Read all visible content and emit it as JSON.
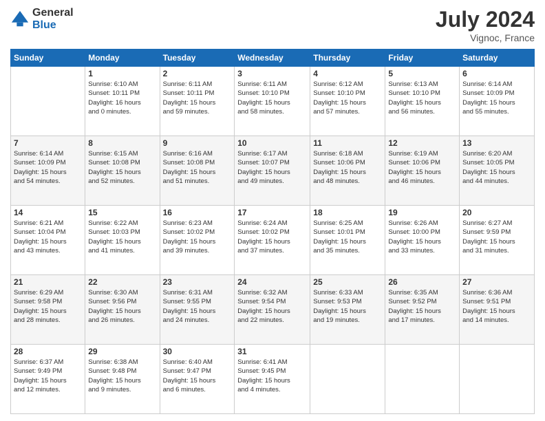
{
  "header": {
    "logo_general": "General",
    "logo_blue": "Blue",
    "month_year": "July 2024",
    "location": "Vignoc, France"
  },
  "weekdays": [
    "Sunday",
    "Monday",
    "Tuesday",
    "Wednesday",
    "Thursday",
    "Friday",
    "Saturday"
  ],
  "weeks": [
    [
      {
        "day": "",
        "info": ""
      },
      {
        "day": "1",
        "info": "Sunrise: 6:10 AM\nSunset: 10:11 PM\nDaylight: 16 hours\nand 0 minutes."
      },
      {
        "day": "2",
        "info": "Sunrise: 6:11 AM\nSunset: 10:11 PM\nDaylight: 15 hours\nand 59 minutes."
      },
      {
        "day": "3",
        "info": "Sunrise: 6:11 AM\nSunset: 10:10 PM\nDaylight: 15 hours\nand 58 minutes."
      },
      {
        "day": "4",
        "info": "Sunrise: 6:12 AM\nSunset: 10:10 PM\nDaylight: 15 hours\nand 57 minutes."
      },
      {
        "day": "5",
        "info": "Sunrise: 6:13 AM\nSunset: 10:10 PM\nDaylight: 15 hours\nand 56 minutes."
      },
      {
        "day": "6",
        "info": "Sunrise: 6:14 AM\nSunset: 10:09 PM\nDaylight: 15 hours\nand 55 minutes."
      }
    ],
    [
      {
        "day": "7",
        "info": "Sunrise: 6:14 AM\nSunset: 10:09 PM\nDaylight: 15 hours\nand 54 minutes."
      },
      {
        "day": "8",
        "info": "Sunrise: 6:15 AM\nSunset: 10:08 PM\nDaylight: 15 hours\nand 52 minutes."
      },
      {
        "day": "9",
        "info": "Sunrise: 6:16 AM\nSunset: 10:08 PM\nDaylight: 15 hours\nand 51 minutes."
      },
      {
        "day": "10",
        "info": "Sunrise: 6:17 AM\nSunset: 10:07 PM\nDaylight: 15 hours\nand 49 minutes."
      },
      {
        "day": "11",
        "info": "Sunrise: 6:18 AM\nSunset: 10:06 PM\nDaylight: 15 hours\nand 48 minutes."
      },
      {
        "day": "12",
        "info": "Sunrise: 6:19 AM\nSunset: 10:06 PM\nDaylight: 15 hours\nand 46 minutes."
      },
      {
        "day": "13",
        "info": "Sunrise: 6:20 AM\nSunset: 10:05 PM\nDaylight: 15 hours\nand 44 minutes."
      }
    ],
    [
      {
        "day": "14",
        "info": "Sunrise: 6:21 AM\nSunset: 10:04 PM\nDaylight: 15 hours\nand 43 minutes."
      },
      {
        "day": "15",
        "info": "Sunrise: 6:22 AM\nSunset: 10:03 PM\nDaylight: 15 hours\nand 41 minutes."
      },
      {
        "day": "16",
        "info": "Sunrise: 6:23 AM\nSunset: 10:02 PM\nDaylight: 15 hours\nand 39 minutes."
      },
      {
        "day": "17",
        "info": "Sunrise: 6:24 AM\nSunset: 10:02 PM\nDaylight: 15 hours\nand 37 minutes."
      },
      {
        "day": "18",
        "info": "Sunrise: 6:25 AM\nSunset: 10:01 PM\nDaylight: 15 hours\nand 35 minutes."
      },
      {
        "day": "19",
        "info": "Sunrise: 6:26 AM\nSunset: 10:00 PM\nDaylight: 15 hours\nand 33 minutes."
      },
      {
        "day": "20",
        "info": "Sunrise: 6:27 AM\nSunset: 9:59 PM\nDaylight: 15 hours\nand 31 minutes."
      }
    ],
    [
      {
        "day": "21",
        "info": "Sunrise: 6:29 AM\nSunset: 9:58 PM\nDaylight: 15 hours\nand 28 minutes."
      },
      {
        "day": "22",
        "info": "Sunrise: 6:30 AM\nSunset: 9:56 PM\nDaylight: 15 hours\nand 26 minutes."
      },
      {
        "day": "23",
        "info": "Sunrise: 6:31 AM\nSunset: 9:55 PM\nDaylight: 15 hours\nand 24 minutes."
      },
      {
        "day": "24",
        "info": "Sunrise: 6:32 AM\nSunset: 9:54 PM\nDaylight: 15 hours\nand 22 minutes."
      },
      {
        "day": "25",
        "info": "Sunrise: 6:33 AM\nSunset: 9:53 PM\nDaylight: 15 hours\nand 19 minutes."
      },
      {
        "day": "26",
        "info": "Sunrise: 6:35 AM\nSunset: 9:52 PM\nDaylight: 15 hours\nand 17 minutes."
      },
      {
        "day": "27",
        "info": "Sunrise: 6:36 AM\nSunset: 9:51 PM\nDaylight: 15 hours\nand 14 minutes."
      }
    ],
    [
      {
        "day": "28",
        "info": "Sunrise: 6:37 AM\nSunset: 9:49 PM\nDaylight: 15 hours\nand 12 minutes."
      },
      {
        "day": "29",
        "info": "Sunrise: 6:38 AM\nSunset: 9:48 PM\nDaylight: 15 hours\nand 9 minutes."
      },
      {
        "day": "30",
        "info": "Sunrise: 6:40 AM\nSunset: 9:47 PM\nDaylight: 15 hours\nand 6 minutes."
      },
      {
        "day": "31",
        "info": "Sunrise: 6:41 AM\nSunset: 9:45 PM\nDaylight: 15 hours\nand 4 minutes."
      },
      {
        "day": "",
        "info": ""
      },
      {
        "day": "",
        "info": ""
      },
      {
        "day": "",
        "info": ""
      }
    ]
  ]
}
